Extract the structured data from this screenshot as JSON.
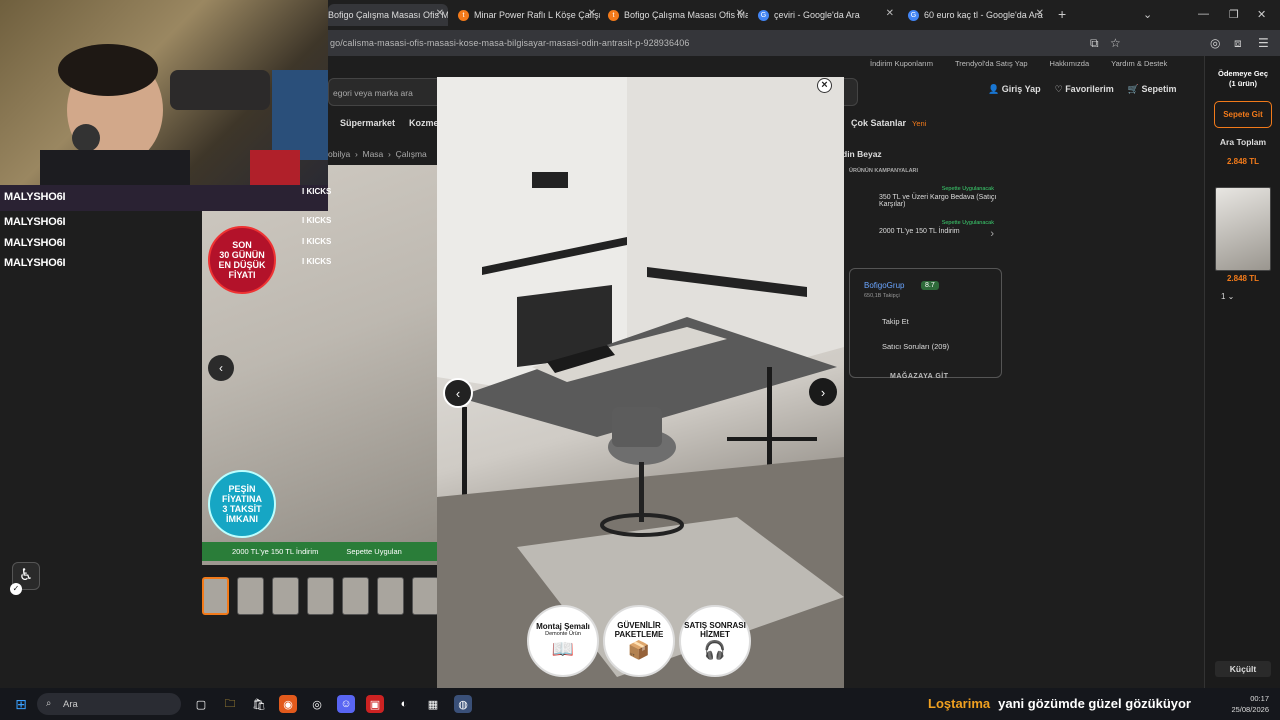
{
  "tabs": [
    {
      "label": "Bofigo Çalışma Masası Ofis Masa",
      "active": true
    },
    {
      "label": "Minar Power Raflı L Köşe Çalışm",
      "active": false
    },
    {
      "label": "Bofigo Çalışma Masası Ofis Mas",
      "active": false
    },
    {
      "label": "çeviri - Google'da Ara",
      "active": false
    },
    {
      "label": "60 euro kaç tl - Google'da Ara",
      "active": false
    }
  ],
  "address": {
    "url": "go/calisma-masasi-ofis-masasi-kose-masa-bilgisayar-masasi-odin-antrasit-p-928936406"
  },
  "topnav": [
    "İndirim Kuponlarım",
    "Trendyol'da Satış Yap",
    "Hakkımızda",
    "Yardım & Destek"
  ],
  "search": {
    "placeholder": "egori veya marka ara"
  },
  "header": {
    "login": "Giriş Yap",
    "favorites": "Favorilerim",
    "cart": "Sepetim"
  },
  "categories": [
    "Süpermarket",
    "Kozme"
  ],
  "best_sellers": {
    "label": "Çok Satanlar",
    "badge": "Yeni"
  },
  "breadcrumb": [
    "obilya",
    "Masa",
    "Çalışma"
  ],
  "product_title_fragment": "din Beyaz",
  "gallery": {
    "badge_top": [
      "SON",
      "30 GÜNÜN",
      "EN DÜŞÜK",
      "FİYATI"
    ],
    "badge_bottom": [
      "PEŞİN",
      "FİYATINA",
      "3 TAKSİT",
      "İMKANI"
    ],
    "green_bar": {
      "campaign": "2000 TL'ye 150 TL İndirim",
      "tag": "Sepette Uygulan"
    },
    "thumb_count": 7
  },
  "campaigns": {
    "heading": "ÜRÜNÜN KAMPANYALARI",
    "items": [
      {
        "tag": "Sepette Uygulanacak",
        "text": "350 TL ve Üzeri Kargo Bedava (Satıcı Karşılar)"
      },
      {
        "tag": "Sepette Uygulanacak",
        "text": "2000 TL'ye 150 TL İndirim"
      }
    ]
  },
  "seller": {
    "name": "BofigoGrup",
    "score": "8.7",
    "followers": "650,1B Takipçi",
    "follow": "Takip Et",
    "questions": "Satıcı Soruları (209)",
    "store": "MAĞAZAYA GİT"
  },
  "cart_panel": {
    "checkout": "Ödemeye Geç (1 ürün)",
    "go_cart": "Sepete Git",
    "subtotal_label": "Ara Toplam",
    "subtotal": "2.848 TL",
    "item_price": "2.848 TL",
    "qty": "1",
    "shrink": "Küçült"
  },
  "modal": {
    "close": "×",
    "badges": [
      {
        "title": "Montaj Şemalı",
        "sub": "Demonte Ürün",
        "icon": "📖"
      },
      {
        "title": "GÜVENİLİR PAKETLEME",
        "sub": "",
        "icon": "📦"
      },
      {
        "title": "SATIŞ SONRASI HİZMET",
        "sub": "",
        "icon": "🎧"
      }
    ]
  },
  "chat": {
    "names": [
      "MALYSHO6I",
      "MALYSHO6I",
      "MALYSHO6I",
      "MALYSHO6I"
    ],
    "msgs": [
      "I KICKS",
      "I KICKS",
      "I KICKS",
      "I KICKS"
    ]
  },
  "taskbar": {
    "search": "Ara",
    "ticker_a": "Loştarima",
    "ticker_b": "yani gözümde güzel gözüküyor",
    "time": "00:17",
    "date": "25/08/2026"
  },
  "colors": {
    "accent": "#f27a1a",
    "green": "#2a7d39",
    "badge_red": "#b3122a"
  }
}
